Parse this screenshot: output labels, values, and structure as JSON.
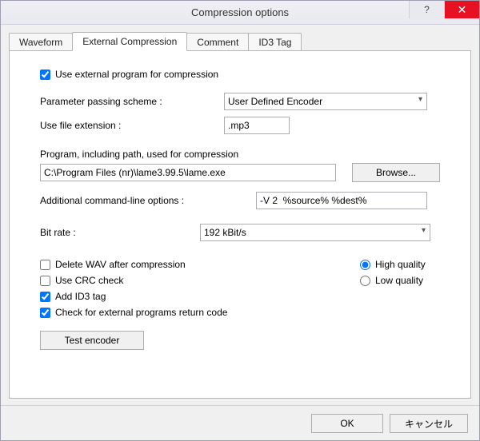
{
  "window": {
    "title": "Compression options",
    "help_label": "?",
    "close_label": "✕"
  },
  "tabs": {
    "waveform": "Waveform",
    "external": "External Compression",
    "comment": "Comment",
    "id3": "ID3 Tag"
  },
  "panel": {
    "use_external_label": "Use external program for compression",
    "use_external_checked": true,
    "param_scheme_label": "Parameter passing scheme :",
    "param_scheme_value": "User Defined Encoder",
    "file_ext_label": "Use file extension :",
    "file_ext_value": ".mp3",
    "program_label": "Program, including path, used for compression",
    "program_value": "C:\\Program Files (nr)\\lame3.99.5\\lame.exe",
    "browse_label": "Browse...",
    "cmd_opts_label": "Additional command-line options :",
    "cmd_opts_value": "-V 2  %source% %dest%",
    "bitrate_label": "Bit rate :",
    "bitrate_value": "192 kBit/s",
    "delete_wav_label": "Delete WAV after compression",
    "delete_wav_checked": false,
    "use_crc_label": "Use CRC check",
    "use_crc_checked": false,
    "add_id3_label": "Add ID3 tag",
    "add_id3_checked": true,
    "check_return_label": "Check for external programs return code",
    "check_return_checked": true,
    "high_quality_label": "High quality",
    "high_quality_selected": true,
    "low_quality_label": "Low quality",
    "low_quality_selected": false,
    "test_encoder_label": "Test encoder"
  },
  "footer": {
    "ok": "OK",
    "cancel": "キャンセル"
  }
}
